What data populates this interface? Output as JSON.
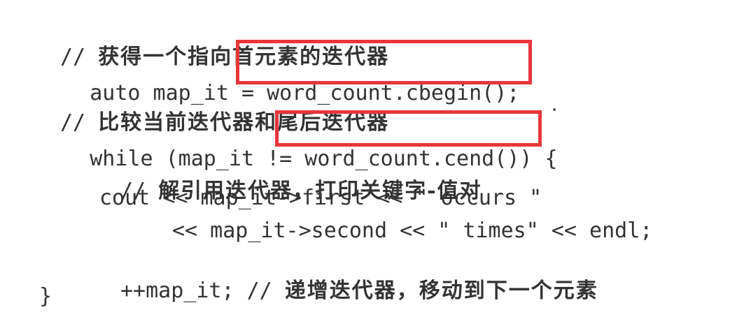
{
  "code": {
    "line1_comment_prefix": "// ",
    "line1_comment_text": "获得一个指向首元素的迭代器",
    "line2_prefix": "auto map_it = ",
    "line2_highlight": "word_count.cbegin();",
    "line3_comment_prefix": "// ",
    "line3_comment_text": "比较当前迭代器和尾后迭代器",
    "line4_prefix": "while (map_it != ",
    "line4_highlight": "word_count.cend())",
    "line4_suffix": " {",
    "line5_comment_prefix": "// ",
    "line5_comment_text": "解引用迭代器，打印关键字-值对",
    "line6": "cout << map_it->first << \" occurs \"",
    "line7": "<< map_it->second << \" times\" << endl;",
    "line8_code": "++map_it; // ",
    "line8_comment_text": "递增迭代器，移动到下一个元素",
    "line9": "}"
  },
  "colors": {
    "highlight_border": "#e8353b",
    "text": "#333333",
    "background": "#ffffff"
  }
}
